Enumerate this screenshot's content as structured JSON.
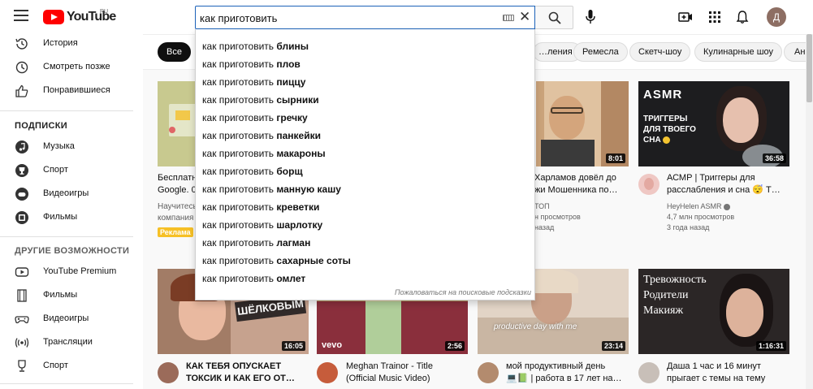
{
  "header": {
    "logo_text": "YouTube",
    "region": "RU",
    "search_value": "как приготовить",
    "avatar_letter": "Д"
  },
  "sidebar": {
    "main": [
      "История",
      "Смотреть позже",
      "Понравившиеся"
    ],
    "subs_heading": "ПОДПИСКИ",
    "subs": [
      "Музыка",
      "Спорт",
      "Видеоигры",
      "Фильмы"
    ],
    "more_heading": "ДРУГИЕ ВОЗМОЖНОСТИ",
    "more": [
      "YouTube Premium",
      "Фильмы",
      "Видеоигры",
      "Трансляции",
      "Спорт"
    ]
  },
  "chips": [
    "Все",
    "…ления",
    "Ремесла",
    "Скетч-шоу",
    "Кулинарные шоу",
    "Ан"
  ],
  "suggestions": {
    "prefix": "как приготовить ",
    "items": [
      "блины",
      "плов",
      "пиццу",
      "сырники",
      "гречку",
      "панкейки",
      "макароны",
      "борщ",
      "манную кашу",
      "креветки",
      "шарлотку",
      "лагман",
      "сахарные соты",
      "омлет"
    ],
    "footer": "Пожаловаться на поисковые подсказки"
  },
  "videos_row1": [
    {
      "title1": "Бесплатн",
      "title2": "Google. 0-",
      "meta1": "Научитесь",
      "meta2": "компания",
      "badge": "Реклама",
      "duration": ""
    },
    {
      "title1": "",
      "title2": "",
      "meta1": "",
      "meta2": "",
      "meta3": "",
      "duration": ""
    },
    {
      "title1": "Харламов довёл до",
      "title2": "жи Мошенника по…",
      "meta1": "ТОП",
      "meta2": "н просмотров",
      "meta3": "назад",
      "duration": "8:01"
    },
    {
      "title1": "АСМР | Триггеры для",
      "title2": "расслабления и сна 😴 Т…",
      "meta1": "HeyHelen ASMR",
      "meta2": "4,7 млн просмотров",
      "meta3": "3 года назад",
      "duration": "36:58",
      "thumb_text1": "ASMR",
      "thumb_text2": "ТРИГГЕРЫ",
      "thumb_text3": "ДЛЯ ТВОЕГО",
      "thumb_text4": "СНА"
    }
  ],
  "videos_row2": [
    {
      "title1": "КАК ТЕБЯ ОПУСКАЕТ",
      "title2": "ТОКСИК И КАК ЕГО ОТ…",
      "duration": "16:05",
      "thumb_text": "ШЁЛКОВЫМ"
    },
    {
      "title1": "Meghan Trainor - Title",
      "title2": "(Official Music Video)",
      "duration": "2:56",
      "thumb_text": "vevo"
    },
    {
      "title1": "мой продуктивный день",
      "title2": "💻📗 | работа в 17 лет на…",
      "duration": "23:14",
      "thumb_text": "productive day with me"
    },
    {
      "title1": "Даша 1 час и 16 минут",
      "title2": "прыгает с темы на тему",
      "duration": "1:16:31",
      "thumb_text1": "Тревожность",
      "thumb_text2": "Родители",
      "thumb_text3": "Макияж"
    }
  ]
}
